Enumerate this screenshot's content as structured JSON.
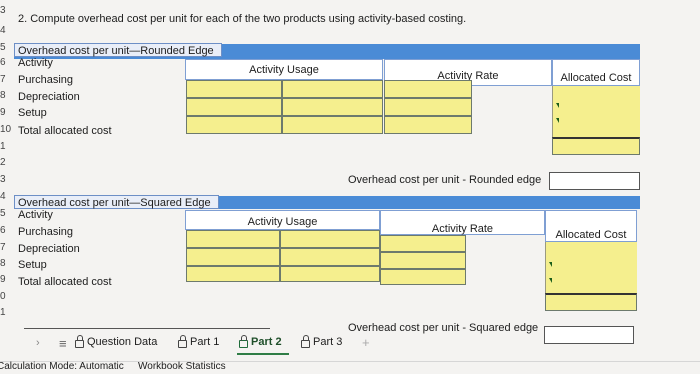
{
  "question": "2. Compute overhead cost per unit for each of the two products using activity-based costing.",
  "row_numbers": [
    "3",
    "4",
    "5",
    "6",
    "7",
    "8",
    "9",
    "10",
    "1",
    "2",
    "3",
    "4",
    "5",
    "6",
    "7",
    "8",
    "9",
    "0",
    "1"
  ],
  "rounded": {
    "title": "Overhead cost per unit—Rounded Edge",
    "headers": {
      "activity": "Activity",
      "usage": "Activity Usage",
      "rate": "Activity Rate",
      "allocated": "Allocated Cost"
    },
    "rows": [
      "Purchasing",
      "Depreciation",
      "Setup"
    ],
    "total_label": "Total allocated cost",
    "per_unit_label": "Overhead cost per unit - Rounded edge"
  },
  "squared": {
    "title": "Overhead cost per unit—Squared Edge",
    "headers": {
      "activity": "Activity",
      "usage": "Activity Usage",
      "rate": "Activity Rate",
      "allocated": "Allocated Cost"
    },
    "rows": [
      "Purchasing",
      "Depreciation",
      "Setup"
    ],
    "total_label": "Total allocated cost",
    "per_unit_label": "Overhead cost per unit - Squared edge"
  },
  "tabs": {
    "menu_icon": "hamburger-icon",
    "items": [
      {
        "label": "Question Data",
        "icon": "lock-icon"
      },
      {
        "label": "Part 1",
        "icon": "lock-icon"
      },
      {
        "label": "Part 2",
        "icon": "lock-icon",
        "active": true
      },
      {
        "label": "Part 3",
        "icon": "lock-icon"
      }
    ],
    "add": "+"
  },
  "status": {
    "calc_mode": "Calculation Mode: Automatic",
    "stats": "Workbook Statistics"
  }
}
